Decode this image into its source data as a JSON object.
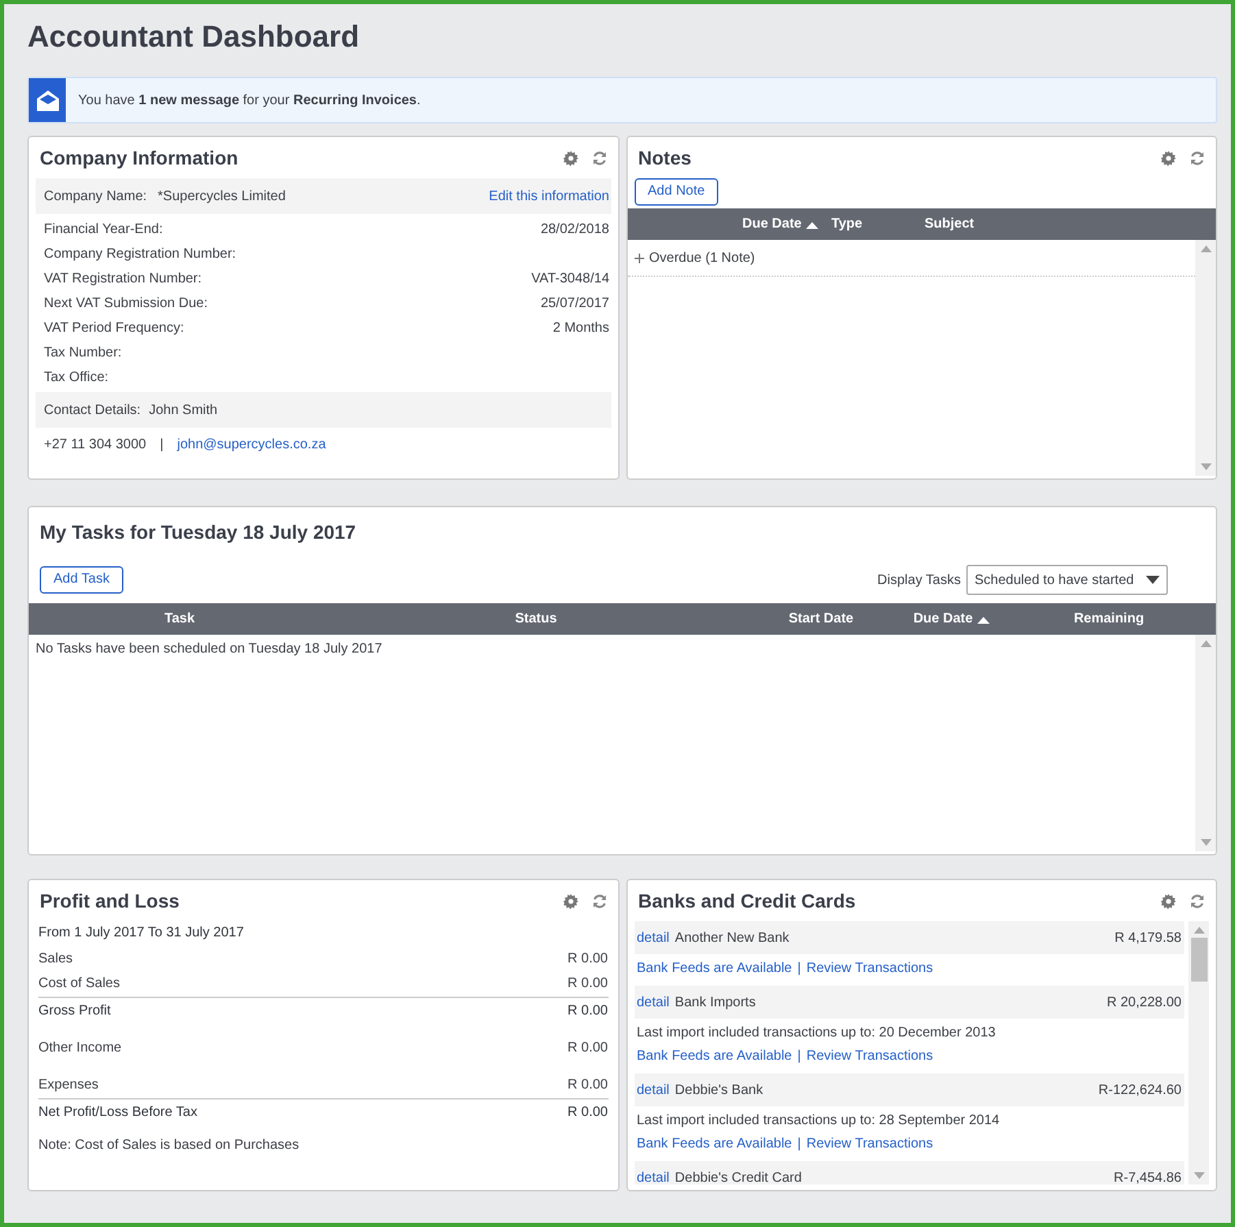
{
  "page_title": "Accountant Dashboard",
  "alert": {
    "text": "You have **1 new message** for your **Recurring Invoices**."
  },
  "company_info": {
    "title": "Company Information",
    "company_name_label": "Company Name:",
    "company_name": "*Supercycles Limited",
    "edit_link": "Edit this information",
    "fields": [
      {
        "label": "Financial Year-End:",
        "value": "28/02/2018"
      },
      {
        "label": "Company Registration Number:"
      },
      {
        "label": "VAT Registration Number:",
        "value": "VAT-3048/14"
      },
      {
        "label": "Next VAT Submission Due:",
        "value": "25/07/2017"
      },
      {
        "label": "VAT Period Frequency:",
        "value": "2 Months"
      },
      {
        "label": "Tax Number:"
      },
      {
        "label": "Tax Office:"
      }
    ],
    "contact_label": "Contact Details:",
    "contact_name": "John Smith",
    "phone": "+27 11 304 3000",
    "separator": "|",
    "email": "john@supercycles.co.za"
  },
  "notes": {
    "title": "Notes",
    "add_button": "Add Note",
    "columns": [
      {
        "label": "Due Date",
        "sorted": true
      },
      {
        "label": "Type",
        "sorted": false
      },
      {
        "label": "Subject",
        "sorted": false
      }
    ],
    "groups": [
      {
        "label": "Overdue (1 Note)",
        "expanded": false
      }
    ]
  },
  "tasks": {
    "title": "My Tasks for Tuesday 18 July 2017",
    "add_button": "Add Task",
    "display_label": "Display Tasks",
    "display_value": "Scheduled to have started",
    "columns": [
      {
        "label": "Task",
        "sorted": false
      },
      {
        "label": "Status",
        "sorted": false
      },
      {
        "label": "Start Date",
        "sorted": false
      },
      {
        "label": "Due Date",
        "sorted": true
      },
      {
        "label": "Remaining",
        "sorted": false
      }
    ],
    "empty_text": "No Tasks have been scheduled on Tuesday 18 July 2017"
  },
  "profit_loss": {
    "title": "Profit and Loss",
    "period": "From 1 July 2017 To 31 July 2017",
    "rows": [
      {
        "kind": "item",
        "label": "Sales",
        "value": "R 0.00"
      },
      {
        "kind": "item",
        "label": "Cost of Sales",
        "value": "R 0.00"
      },
      {
        "kind": "total",
        "label": "Gross Profit",
        "value": "R 0.00"
      },
      {
        "kind": "section",
        "label": "Other Income",
        "value": "R 0.00"
      },
      {
        "kind": "section",
        "label": "Expenses",
        "value": "R 0.00"
      },
      {
        "kind": "total",
        "label": "Net Profit/Loss Before Tax",
        "value": "R 0.00"
      }
    ],
    "note": "Note: Cost of Sales is based on Purchases"
  },
  "banks": {
    "title": "Banks and Credit Cards",
    "accounts": [
      {
        "detail_link": "detail",
        "name": "Another New Bank",
        "balance": "R 4,179.58",
        "feeds_link": "Bank Feeds are Available",
        "separator": "|",
        "review_link": "Review Transactions"
      },
      {
        "detail_link": "detail",
        "name": "Bank Imports",
        "balance": "R 20,228.00",
        "import_note": "Last import included transactions up to: 20 December 2013",
        "feeds_link": "Bank Feeds are Available",
        "separator": "|",
        "review_link": "Review Transactions"
      },
      {
        "detail_link": "detail",
        "name": "Debbie's Bank",
        "balance": "R-122,624.60",
        "import_note": "Last import included transactions up to: 28 September 2014",
        "feeds_link": "Bank Feeds are Available",
        "separator": "|",
        "review_link": "Review Transactions"
      },
      {
        "detail_link": "detail",
        "name": "Debbie's Credit Card",
        "balance": "R-7,454.86"
      }
    ]
  }
}
